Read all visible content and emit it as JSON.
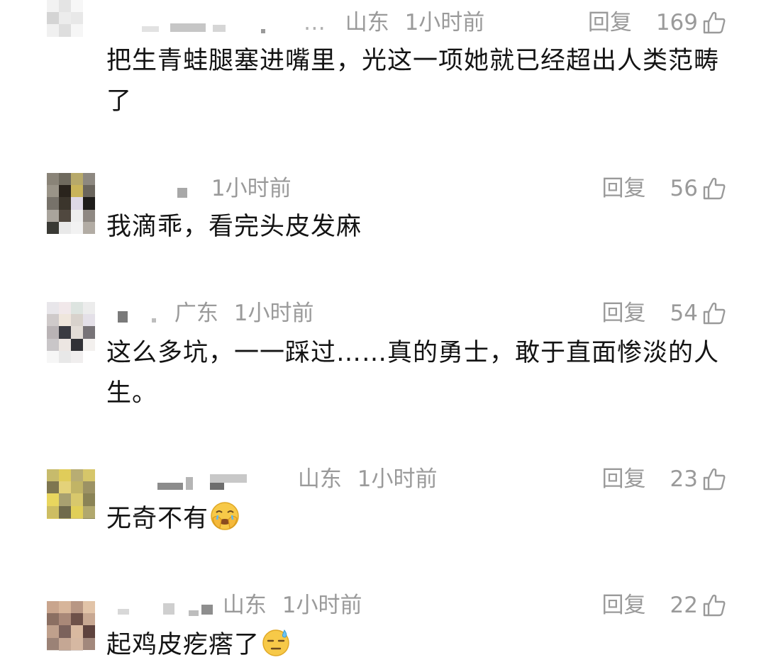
{
  "comments": [
    {
      "location": "山东",
      "time": "1小时前",
      "reply_label": "回复",
      "likes": "169",
      "text": "把生青蛙腿塞进嘴里，光这一项她就已经超出人类范畴了",
      "avatar_colors": [
        "#f2f2f2",
        "#e4e4e4",
        "#f7f7f7",
        "#ffffff",
        "#d4d4d4",
        "#ececec",
        "#e8e8e8",
        "#ffffff",
        "#f0f0f0",
        "#dedede",
        "#f6f6f6",
        "#ffffff",
        "#ffffff",
        "#ffffff",
        "#ffffff",
        "#ffffff",
        "#ffffff",
        "#ffffff",
        "#ffffff",
        "#ffffff"
      ]
    },
    {
      "location": "",
      "time": "1小时前",
      "reply_label": "回复",
      "likes": "56",
      "text": "我滴乖，看完头皮发麻",
      "avatar_colors": [
        "#8a8478",
        "#6f6a5e",
        "#b7a96a",
        "#8d8880",
        "#9a9488",
        "#2a241d",
        "#c9b45a",
        "#6a655d",
        "#77726a",
        "#3b352c",
        "#ded8e6",
        "#1e1c1a",
        "#a9a49c",
        "#50483f",
        "#eeeeee",
        "#8e8882",
        "#3a3a35",
        "#e9e9e9",
        "#f2f2f2",
        "#b2aca4"
      ]
    },
    {
      "location": "广东",
      "time": "1小时前",
      "reply_label": "回复",
      "likes": "54",
      "text": "这么多坑，一一踩过……真的勇士，敢于直面惨淡的人生。",
      "avatar_colors": [
        "#e8e6ea",
        "#f1e8ea",
        "#dde4e0",
        "#ececec",
        "#cfcaca",
        "#efe6dc",
        "#d8d2cc",
        "#e4e0e8",
        "#b9b3b5",
        "#3b3b42",
        "#e2dcd6",
        "#777377",
        "#c9c6c8",
        "#ece6e2",
        "#313136",
        "#f3f0ee",
        "#f6f6f6",
        "#e8e8e8",
        "#f0eeee",
        "#ffffff"
      ]
    },
    {
      "location": "山东",
      "time": "1小时前",
      "reply_label": "回复",
      "likes": "23",
      "text": "无奇不有",
      "emoji": "face-palm-emoji",
      "avatar_colors": [
        "#c7bb6c",
        "#e0cc5a",
        "#b8ad73",
        "#d6c66a",
        "#7e7650",
        "#e4d27a",
        "#c1b466",
        "#9c9264",
        "#e9d65e",
        "#a8a070",
        "#d8c86c",
        "#8a8356",
        "#cdbd62",
        "#6f6a4c",
        "#e1cf58",
        "#b1a86e",
        "#dcc85c",
        "#a59c60",
        "#d0c070",
        "#8f8858"
      ]
    },
    {
      "location": "山东",
      "time": "1小时前",
      "reply_label": "回复",
      "likes": "22",
      "text": "起鸡皮疙瘩了",
      "emoji": "sweat-emoji",
      "avatar_colors": [
        "#c9a58d",
        "#d7b59a",
        "#b89784",
        "#e2c4a8",
        "#8b6f62",
        "#a98878",
        "#6e5149",
        "#c8a892",
        "#bfa08c",
        "#7b625c",
        "#d9b9a0",
        "#5e433e",
        "#9b8276",
        "#c5a794",
        "#d6b8a2",
        "#a2887c",
        "#e6e0dc",
        "#bdb2ac",
        "#d8cfca",
        "#ffffff"
      ]
    }
  ]
}
